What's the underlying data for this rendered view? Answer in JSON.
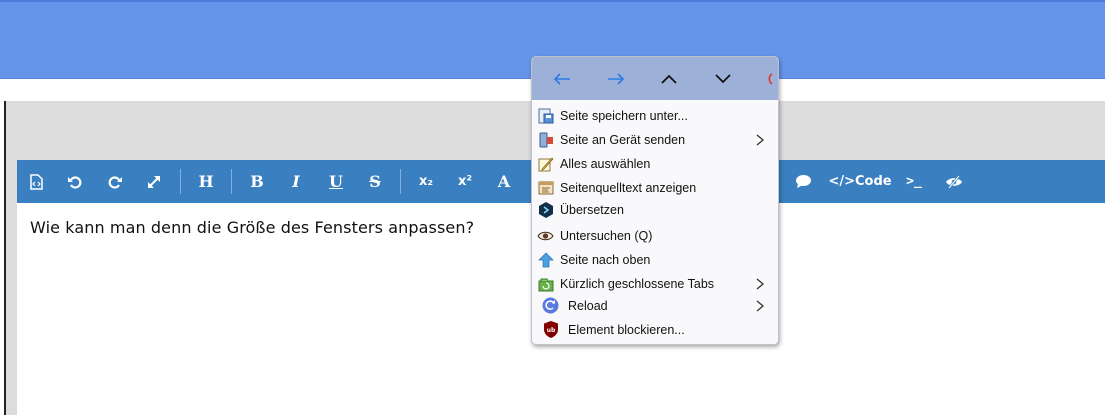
{
  "editor": {
    "content": "Wie kann man denn die Größe des Fensters anpassen?",
    "toolbar": {
      "heading": "H",
      "bold": "B",
      "italic": "I",
      "underline": "U",
      "strike": "S",
      "subscript": "x₂",
      "superscript": "x²",
      "font": "A",
      "code": "</>Code",
      "terminal": ">_"
    }
  },
  "context_menu": {
    "items": [
      {
        "label": "Seite speichern unter...",
        "icon": "save-page-icon"
      },
      {
        "label": "Seite an Gerät senden",
        "icon": "send-device-icon",
        "submenu": true
      },
      {
        "label": "Alles auswählen",
        "icon": "select-all-icon"
      },
      {
        "label": "Seitenquelltext anzeigen",
        "icon": "view-source-icon"
      },
      {
        "label": "Übersetzen",
        "icon": "translate-icon"
      },
      {
        "label": "Untersuchen (Q)",
        "icon": "inspect-eye-icon"
      },
      {
        "label": "Seite nach oben",
        "icon": "arrow-up-icon"
      },
      {
        "label": "Kürzlich geschlossene Tabs",
        "icon": "closed-tabs-icon",
        "submenu": true
      },
      {
        "label": "Reload",
        "icon": "reload-icon",
        "submenu": true
      },
      {
        "label": "Element blockieren...",
        "icon": "ublock-icon"
      }
    ]
  },
  "colors": {
    "banner": "#6495ea",
    "toolbar": "#3a7fbf",
    "menu_nav": "#9cb0d8",
    "nav_arrow": "#2f7be6"
  }
}
